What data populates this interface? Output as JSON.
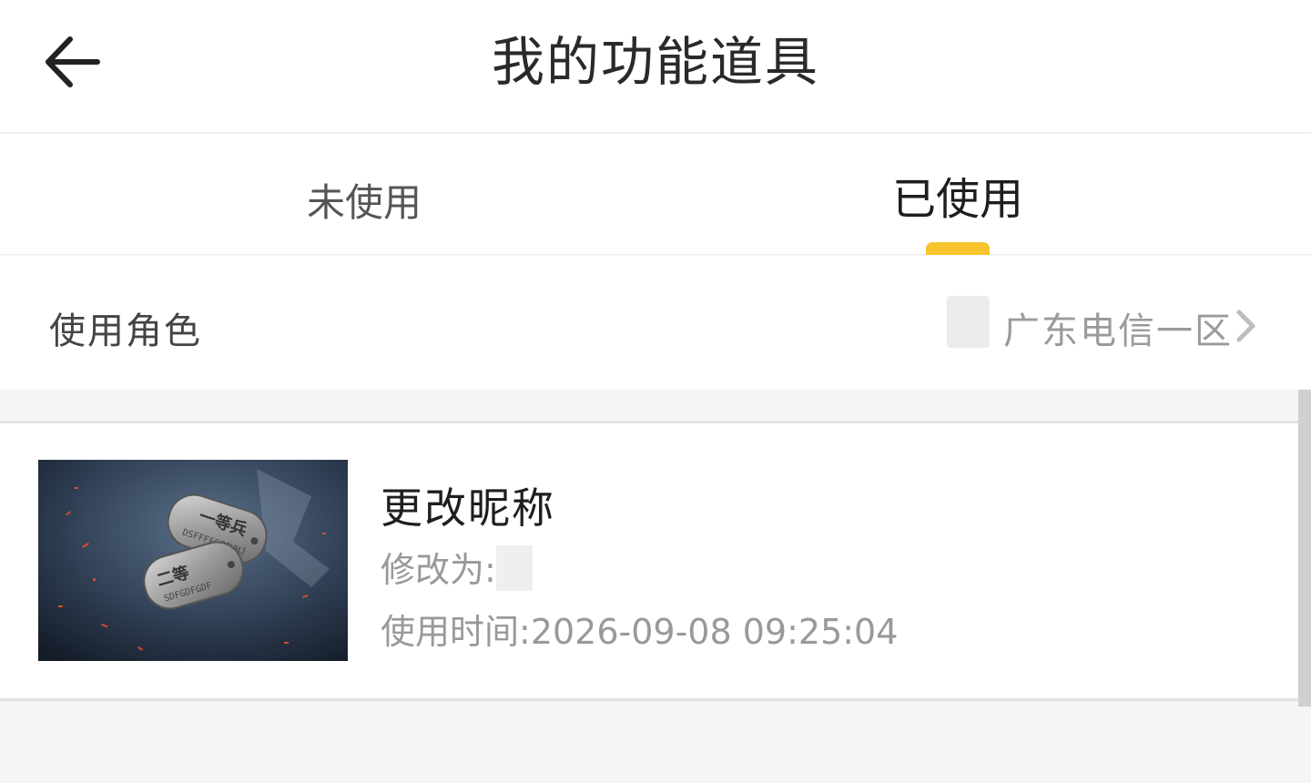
{
  "header": {
    "title": "我的功能道具",
    "back_icon": "arrow-left-icon"
  },
  "tabs": [
    {
      "label": "未使用",
      "active": false
    },
    {
      "label": "已使用",
      "active": true
    }
  ],
  "accent_color": "#f7c42e",
  "role": {
    "label": "使用角色",
    "server": "广东电信一区",
    "chevron_icon": "chevron-right-icon"
  },
  "items": [
    {
      "name": "更改昵称",
      "changed_to_label": "修改为:",
      "used_time_label": "使用时间:",
      "used_time": "2026-09-08 09:25:04",
      "tag_top_text": "一等兵",
      "tag_bottom_text": "二等"
    }
  ]
}
